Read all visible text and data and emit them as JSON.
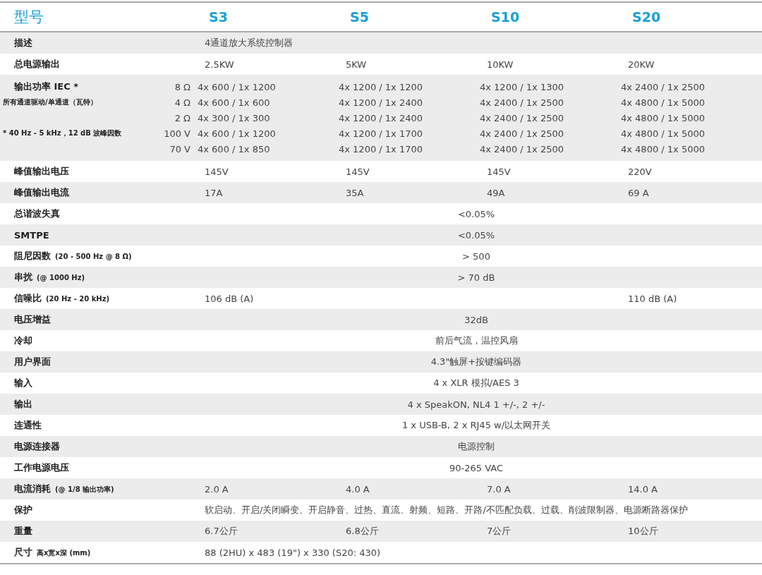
{
  "header": {
    "title": "型号",
    "models": [
      "S3",
      "S5",
      "S10",
      "S20"
    ]
  },
  "rows": [
    {
      "kind": "text",
      "label": "描述",
      "value": "4通道放大系统控制器"
    },
    {
      "kind": "models",
      "label": "总电源输出",
      "values": [
        "2.5KW",
        "5KW",
        "10KW",
        "20KW"
      ]
    },
    {
      "kind": "power",
      "lines": [
        {
          "caption": "输出功率 IEC *",
          "load": "8 Ω",
          "values": [
            "4x 600 / 1x 1200",
            "4x 1200 / 1x 1200",
            "4x 1200 / 1x 1300",
            "4x 2400 / 1x 2500"
          ]
        },
        {
          "caption": "所有通道驱动/单通道（瓦特）",
          "load": "4 Ω",
          "values": [
            "4x 600 / 1x 600",
            "4x 1200 / 1x 2400",
            "4x 2400 / 1x 2500",
            "4x 4800 / 1x 5000"
          ]
        },
        {
          "load": "2 Ω",
          "values": [
            "4x 300 / 1x 300",
            "4x 1200 / 1x 2400",
            "4x 2400 / 1x 2500",
            "4x 4800 / 1x 5000"
          ]
        },
        {
          "caption": "* 40 Hz - 5 kHz，12 dB 波峰因数",
          "load": "100 V",
          "values": [
            "4x 600 / 1x 1200",
            "4x 1200 / 1x 1700",
            "4x 2400 / 1x 2500",
            "4x 4800 / 1x 5000"
          ]
        },
        {
          "load": "70 V",
          "values": [
            "4x 600 / 1x 850",
            "4x 1200 / 1x 1700",
            "4x 2400 / 1x 2500",
            "4x 4800 / 1x 5000"
          ]
        }
      ]
    },
    {
      "kind": "models",
      "label": "峰值输出电压",
      "values": [
        "145V",
        "145V",
        "145V",
        "220V"
      ]
    },
    {
      "kind": "models",
      "label": "峰值输出电流",
      "values": [
        "17A",
        "35A",
        "49A",
        "69 A"
      ]
    },
    {
      "kind": "span",
      "label": "总谐波失真",
      "value": "<0.05%"
    },
    {
      "kind": "span",
      "label": "SMTPE",
      "value": "<0.05%"
    },
    {
      "kind": "span",
      "label": "阻尼因数",
      "note": "(20 - 500 Hz @ 8 Ω)",
      "value": "> 500"
    },
    {
      "kind": "span",
      "label": "串扰",
      "note": "(@ 1000 Hz)",
      "value": "> 70 dB"
    },
    {
      "kind": "ends",
      "label": "信噪比",
      "note": "(20 Hz - 20 kHz)",
      "first": "106 dB (A)",
      "last": "110 dB (A)"
    },
    {
      "kind": "span",
      "label": "电压增益",
      "value": "32dB"
    },
    {
      "kind": "span",
      "label": "冷却",
      "value": "前后气流，温控风扇"
    },
    {
      "kind": "span",
      "label": "用户界面",
      "value": "4.3\"触屏+按键编码器"
    },
    {
      "kind": "span",
      "label": "输入",
      "value": "4 x XLR 模拟/AES 3"
    },
    {
      "kind": "span",
      "label": "输出",
      "value": "4 x SpeakON, NL4 1 +/-, 2 +/-"
    },
    {
      "kind": "span",
      "label": "连通性",
      "value": "1 x USB-B, 2 x RJ45 w/以太网开关"
    },
    {
      "kind": "span",
      "label": "电源连接器",
      "value": "电源控制"
    },
    {
      "kind": "span",
      "label": "工作电源电压",
      "value": "90-265 VAC"
    },
    {
      "kind": "models",
      "label": "电流消耗",
      "note": "(@ 1/8 输出功率)",
      "values": [
        "2.0 A",
        "4.0 A",
        "7.0 A",
        "14.0 A"
      ]
    },
    {
      "kind": "text",
      "label": "保护",
      "value": "软启动、开启/关闭瞬变、开启静音、过热、直流、射频、短路、开路/不匹配负载、过载、削波限制器、电源断路器保护"
    },
    {
      "kind": "models",
      "label": "重量",
      "values": [
        "6.7公斤",
        "6.8公斤",
        "7公斤",
        "10公斤"
      ]
    },
    {
      "kind": "text",
      "label": "尺寸",
      "note": "高x宽x深 (mm)",
      "value": "88 (2HU) x 483 (19\") x 330 (S20: 430)"
    }
  ]
}
